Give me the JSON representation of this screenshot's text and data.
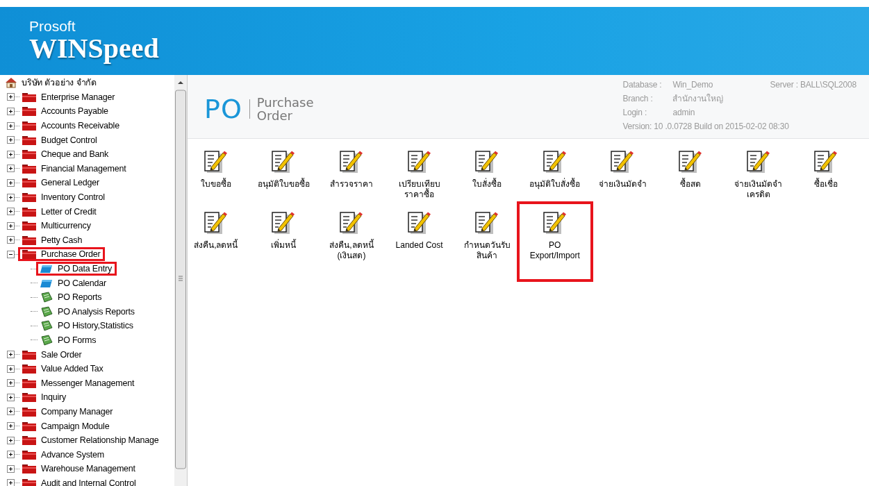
{
  "header": {
    "brand_small": "Prosoft",
    "brand_large": "WINSpeed"
  },
  "sidebar": {
    "tree": [
      {
        "label": "บริษัท ตัวอย่าง จำกัด",
        "kind": "company",
        "highlighted": false,
        "children": [
          {
            "label": "Enterprise Manager",
            "kind": "folder",
            "expanded": false,
            "highlighted": false
          },
          {
            "label": "Accounts Payable",
            "kind": "folder",
            "expanded": false,
            "highlighted": false
          },
          {
            "label": "Accounts Receivable",
            "kind": "folder",
            "expanded": false,
            "highlighted": false
          },
          {
            "label": "Budget Control",
            "kind": "folder",
            "expanded": false,
            "highlighted": false
          },
          {
            "label": "Cheque and Bank",
            "kind": "folder",
            "expanded": false,
            "highlighted": false
          },
          {
            "label": "Financial Management",
            "kind": "folder",
            "expanded": false,
            "highlighted": false
          },
          {
            "label": "General Ledger",
            "kind": "folder",
            "expanded": false,
            "highlighted": false
          },
          {
            "label": "Inventory Control",
            "kind": "folder",
            "expanded": false,
            "highlighted": false
          },
          {
            "label": "Letter of Credit",
            "kind": "folder",
            "expanded": false,
            "highlighted": false
          },
          {
            "label": "Multicurrency",
            "kind": "folder",
            "expanded": false,
            "highlighted": false
          },
          {
            "label": "Petty Cash",
            "kind": "folder",
            "expanded": false,
            "highlighted": false
          },
          {
            "label": "Purchase Order",
            "kind": "folder",
            "expanded": true,
            "highlighted": true,
            "children": [
              {
                "label": "PO Data Entry",
                "kind": "entry",
                "highlighted": true
              },
              {
                "label": "PO Calendar",
                "kind": "entry",
                "highlighted": false
              },
              {
                "label": "PO Reports",
                "kind": "report",
                "highlighted": false
              },
              {
                "label": "PO Analysis Reports",
                "kind": "report",
                "highlighted": false
              },
              {
                "label": "PO History,Statistics",
                "kind": "report",
                "highlighted": false
              },
              {
                "label": "PO Forms",
                "kind": "report",
                "highlighted": false
              }
            ]
          },
          {
            "label": "Sale Order",
            "kind": "folder",
            "expanded": false,
            "highlighted": false
          },
          {
            "label": "Value Added Tax",
            "kind": "folder",
            "expanded": false,
            "highlighted": false
          },
          {
            "label": "Messenger Management",
            "kind": "folder",
            "expanded": false,
            "highlighted": false
          },
          {
            "label": "Inquiry",
            "kind": "folder",
            "expanded": false,
            "highlighted": false
          },
          {
            "label": "Company Manager",
            "kind": "folder",
            "expanded": false,
            "highlighted": false
          },
          {
            "label": "Campaign Module",
            "kind": "folder",
            "expanded": false,
            "highlighted": false
          },
          {
            "label": "Customer Relationship Manage",
            "kind": "folder",
            "expanded": false,
            "highlighted": false
          },
          {
            "label": "Advance System",
            "kind": "folder",
            "expanded": false,
            "highlighted": false
          },
          {
            "label": "Warehouse Management",
            "kind": "folder",
            "expanded": false,
            "highlighted": false
          },
          {
            "label": "Audit and Internal Control",
            "kind": "folder",
            "expanded": false,
            "highlighted": false
          }
        ]
      }
    ]
  },
  "module": {
    "code": "PO",
    "name_line1": "Purchase",
    "name_line2": "Order"
  },
  "info": {
    "database_label": "Database :",
    "database": "Win_Demo",
    "server_label": "Server :",
    "server": "BALL\\SQL2008",
    "branch_label": "Branch :",
    "branch": "สำนักงานใหญ่",
    "login_label": "Login :",
    "login": "admin",
    "version": "Version: 10 .0.0728  Build on 2015-02-02 08:30"
  },
  "programs": [
    {
      "label": [
        "ใบขอซื้อ"
      ],
      "highlighted": false
    },
    {
      "label": [
        "อนุมัติใบขอซื้อ"
      ],
      "highlighted": false
    },
    {
      "label": [
        "สำรวจราคา"
      ],
      "highlighted": false
    },
    {
      "label": [
        "เปรียบเทียบ",
        "ราคาซื้อ"
      ],
      "highlighted": false
    },
    {
      "label": [
        "ใบสั่งซื้อ"
      ],
      "highlighted": false
    },
    {
      "label": [
        "อนุมัติใบสั่งซื้อ"
      ],
      "highlighted": false
    },
    {
      "label": [
        "จ่ายเงินมัดจำ"
      ],
      "highlighted": false
    },
    {
      "label": [
        "ซื้อสด"
      ],
      "highlighted": false
    },
    {
      "label": [
        "จ่ายเงินมัดจำ",
        "เครดิต"
      ],
      "highlighted": false
    },
    {
      "label": [
        "ซื้อเชื่อ"
      ],
      "highlighted": false
    },
    {
      "label": [
        "ส่งคืน,ลดหนี้"
      ],
      "highlighted": false
    },
    {
      "label": [
        "เพิ่มหนี้"
      ],
      "highlighted": false
    },
    {
      "label": [
        "ส่งคืน,ลดหนี้",
        "(เงินสด)"
      ],
      "highlighted": false
    },
    {
      "label": [
        "Landed Cost"
      ],
      "highlighted": false
    },
    {
      "label": [
        "กำหนดวันรับ",
        "สินค้า"
      ],
      "highlighted": false
    },
    {
      "label": [
        "PO",
        "Export/Import"
      ],
      "highlighted": true
    }
  ]
}
